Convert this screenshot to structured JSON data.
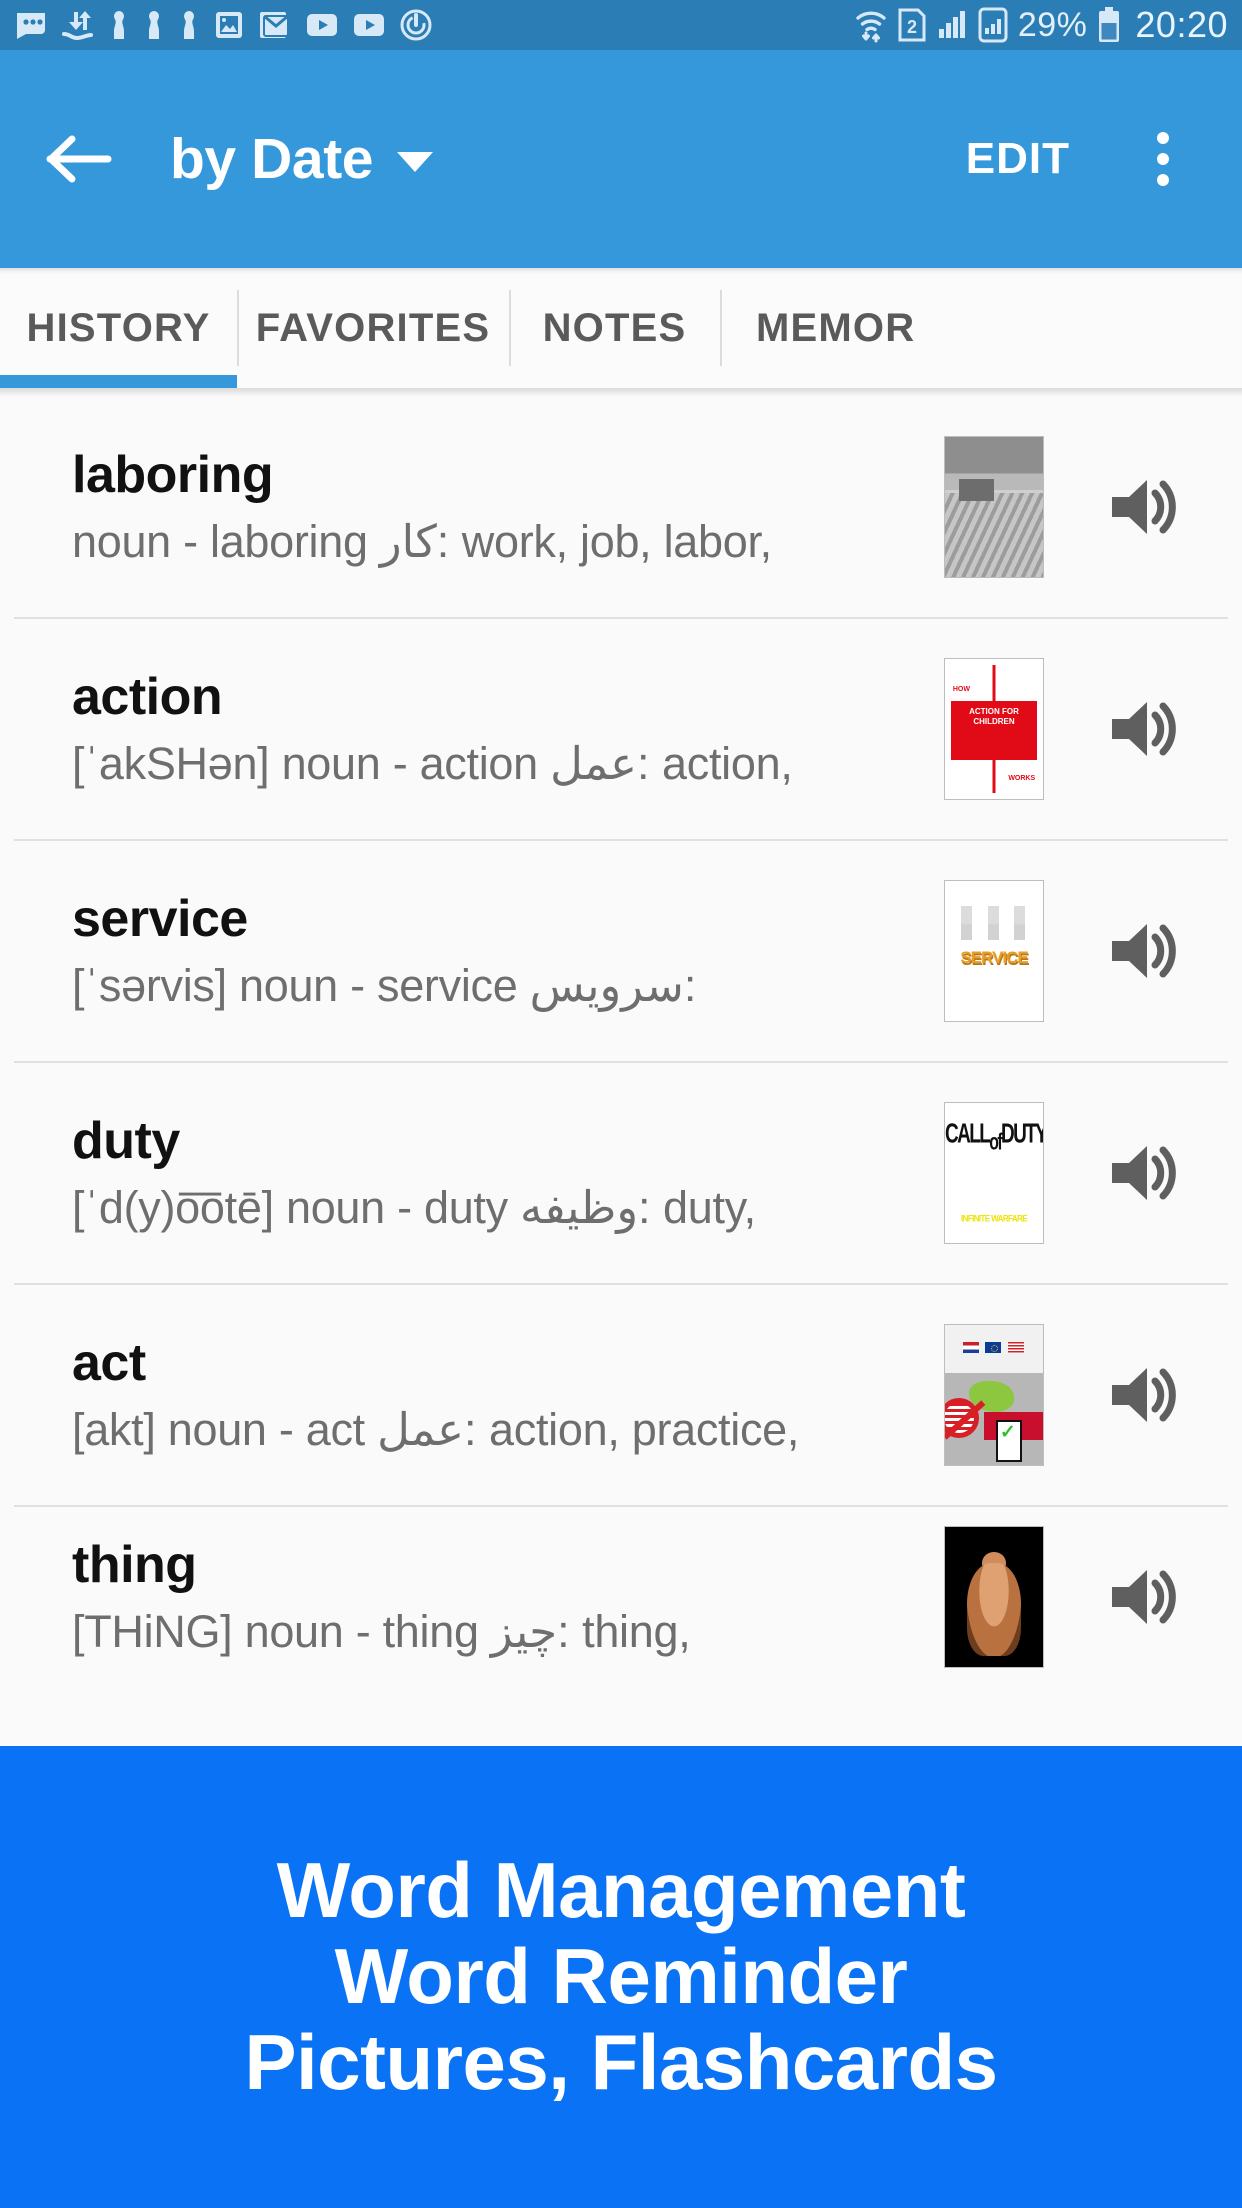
{
  "status_bar": {
    "battery_percent": "29%",
    "clock": "20:20",
    "sim_label": "2",
    "icons": [
      "chat-bubble-icon",
      "data-transfer-icon",
      "contact-silhouette-icon",
      "contact-silhouette-icon",
      "contact-silhouette-icon",
      "photos-icon",
      "gmail-icon",
      "youtube-icon",
      "youtube-icon",
      "power-saving-icon",
      "wifi-icon",
      "sim-indicator-icon",
      "signal-bars-icon",
      "signal-card-icon",
      "battery-icon"
    ]
  },
  "app_bar": {
    "back_icon": "arrow-left-icon",
    "title": "by Date",
    "dropdown_icon": "caret-down-icon",
    "edit_label": "EDIT",
    "overflow_icon": "more-vertical-icon",
    "background_color": "#3498db"
  },
  "tabs": {
    "active_index": 0,
    "indicator_color": "#3498db",
    "items": [
      {
        "label": "HISTORY"
      },
      {
        "label": "FAVORITES"
      },
      {
        "label": "NOTES"
      },
      {
        "label": "MEMOR"
      }
    ]
  },
  "list": {
    "items": [
      {
        "word": "laboring",
        "meaning": "noun - laboring کار: work, job, labor,",
        "thumbnail": "field-workers-photo",
        "speaker_icon": "speaker-icon"
      },
      {
        "word": "action",
        "meaning": "[ˈakSHən] noun - action عمل: action,",
        "thumbnail": "action-for-children-logo",
        "speaker_icon": "speaker-icon"
      },
      {
        "word": "service",
        "meaning": "[ˈsərvis] noun - service سرویس:",
        "thumbnail": "service-3d-text",
        "speaker_icon": "speaker-icon"
      },
      {
        "word": "duty",
        "meaning": "[ˈd(y)o͞otē] noun - duty وظیفه: duty,",
        "thumbnail": "call-of-duty-infinite-warfare-logo",
        "speaker_icon": "speaker-icon"
      },
      {
        "word": "act",
        "meaning": "[akt] noun - act عمل: action, practice,",
        "thumbnail": "flags-ballot-collage",
        "speaker_icon": "speaker-icon"
      },
      {
        "word": "thing",
        "meaning": "[THiNG] noun - thing چیز: thing,",
        "thumbnail": "bodybuilder-photo",
        "speaker_icon": "speaker-icon"
      }
    ]
  },
  "banner": {
    "background_color": "#0a72f5",
    "lines": [
      "Word Management",
      "Word Reminder",
      "Pictures, Flashcards"
    ]
  },
  "thumb_art": {
    "afc": {
      "top": "HOW",
      "mid": "ACTION FOR<br>CHILDREN",
      "bottom": "WORKS"
    },
    "service": {
      "text": "SERVICE"
    },
    "cod": {
      "line1": "CALL<sub>of</sub>DUTY",
      "line2": "INFINITE WARFARE"
    }
  }
}
